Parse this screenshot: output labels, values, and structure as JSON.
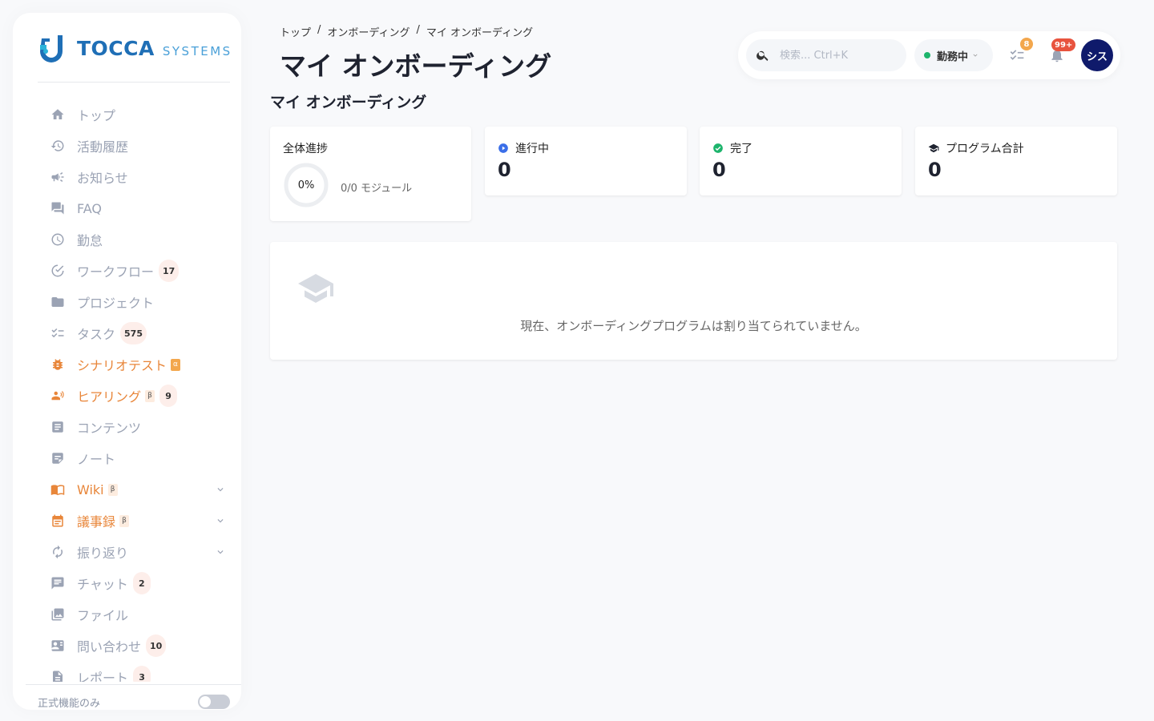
{
  "brand": {
    "name_main": "TOCCA",
    "name_sub": "SYSTEMS"
  },
  "sidebar": {
    "items": [
      {
        "label": "トップ",
        "icon": "home-icon"
      },
      {
        "label": "活動履歴",
        "icon": "history-icon"
      },
      {
        "label": "お知らせ",
        "icon": "megaphone-icon"
      },
      {
        "label": "FAQ",
        "icon": "forum-icon"
      },
      {
        "label": "勤怠",
        "icon": "clock-icon"
      },
      {
        "label": "ワークフロー",
        "icon": "check-circle-icon",
        "badge": "17"
      },
      {
        "label": "プロジェクト",
        "icon": "folder-icon"
      },
      {
        "label": "タスク",
        "icon": "checklist-icon",
        "badge": "575"
      },
      {
        "label": "シナリオテスト",
        "icon": "bug-icon",
        "tag": "α"
      },
      {
        "label": "ヒアリング",
        "icon": "people-icon",
        "tag": "β",
        "badge": "9"
      },
      {
        "label": "コンテンツ",
        "icon": "article-icon"
      },
      {
        "label": "ノート",
        "icon": "note-icon"
      },
      {
        "label": "Wiki",
        "icon": "book-icon",
        "tag": "β"
      },
      {
        "label": "議事録",
        "icon": "calendar-icon",
        "tag": "β"
      },
      {
        "label": "振り返り",
        "icon": "refresh-icon"
      },
      {
        "label": "チャット",
        "icon": "chat-icon",
        "badge": "2"
      },
      {
        "label": "ファイル",
        "icon": "image-icon"
      },
      {
        "label": "問い合わせ",
        "icon": "contact-icon",
        "badge": "10"
      },
      {
        "label": "レポート",
        "icon": "report-icon",
        "badge": "3"
      }
    ],
    "footer_label": "正式機能のみ"
  },
  "header": {
    "breadcrumb": [
      "トップ",
      "オンボーディング",
      "マイ オンボーディング"
    ],
    "breadcrumb_sep": "/",
    "title": "マイ オンボーディング"
  },
  "toolbar": {
    "search_placeholder": "検索... Ctrl+K",
    "status_label": "勤務中",
    "tasks_badge": "8",
    "notifications_badge": "99+",
    "avatar_text": "シス"
  },
  "main": {
    "section_title": "マイ オンボーディング",
    "overall": {
      "label": "全体進捗",
      "percent_text": "0%",
      "modules_text": "0/0 モジュール"
    },
    "stats": [
      {
        "label": "進行中",
        "value": "0"
      },
      {
        "label": "完了",
        "value": "0"
      },
      {
        "label": "プログラム合計",
        "value": "0"
      }
    ],
    "empty_message": "現在、オンボーディングプログラムは割り当てられていません。"
  },
  "colors": {
    "accent_orange": "#e8863a",
    "avatar_bg": "#0f1a6b",
    "status_green": "#1db46c",
    "badge_notif": "#e8533e",
    "badge_task": "#f3a74d"
  }
}
